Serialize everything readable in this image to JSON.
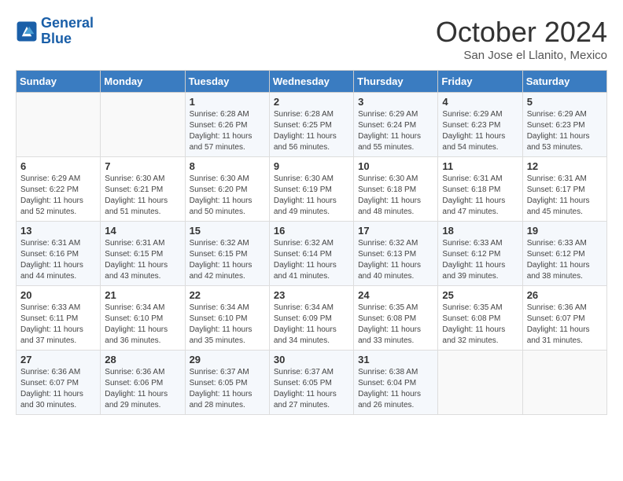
{
  "logo": {
    "text_general": "General",
    "text_blue": "Blue"
  },
  "header": {
    "month": "October 2024",
    "location": "San Jose el Llanito, Mexico"
  },
  "weekdays": [
    "Sunday",
    "Monday",
    "Tuesday",
    "Wednesday",
    "Thursday",
    "Friday",
    "Saturday"
  ],
  "weeks": [
    [
      {
        "day": "",
        "sunrise": "",
        "sunset": "",
        "daylight": ""
      },
      {
        "day": "",
        "sunrise": "",
        "sunset": "",
        "daylight": ""
      },
      {
        "day": "1",
        "sunrise": "Sunrise: 6:28 AM",
        "sunset": "Sunset: 6:26 PM",
        "daylight": "Daylight: 11 hours and 57 minutes."
      },
      {
        "day": "2",
        "sunrise": "Sunrise: 6:28 AM",
        "sunset": "Sunset: 6:25 PM",
        "daylight": "Daylight: 11 hours and 56 minutes."
      },
      {
        "day": "3",
        "sunrise": "Sunrise: 6:29 AM",
        "sunset": "Sunset: 6:24 PM",
        "daylight": "Daylight: 11 hours and 55 minutes."
      },
      {
        "day": "4",
        "sunrise": "Sunrise: 6:29 AM",
        "sunset": "Sunset: 6:23 PM",
        "daylight": "Daylight: 11 hours and 54 minutes."
      },
      {
        "day": "5",
        "sunrise": "Sunrise: 6:29 AM",
        "sunset": "Sunset: 6:23 PM",
        "daylight": "Daylight: 11 hours and 53 minutes."
      }
    ],
    [
      {
        "day": "6",
        "sunrise": "Sunrise: 6:29 AM",
        "sunset": "Sunset: 6:22 PM",
        "daylight": "Daylight: 11 hours and 52 minutes."
      },
      {
        "day": "7",
        "sunrise": "Sunrise: 6:30 AM",
        "sunset": "Sunset: 6:21 PM",
        "daylight": "Daylight: 11 hours and 51 minutes."
      },
      {
        "day": "8",
        "sunrise": "Sunrise: 6:30 AM",
        "sunset": "Sunset: 6:20 PM",
        "daylight": "Daylight: 11 hours and 50 minutes."
      },
      {
        "day": "9",
        "sunrise": "Sunrise: 6:30 AM",
        "sunset": "Sunset: 6:19 PM",
        "daylight": "Daylight: 11 hours and 49 minutes."
      },
      {
        "day": "10",
        "sunrise": "Sunrise: 6:30 AM",
        "sunset": "Sunset: 6:18 PM",
        "daylight": "Daylight: 11 hours and 48 minutes."
      },
      {
        "day": "11",
        "sunrise": "Sunrise: 6:31 AM",
        "sunset": "Sunset: 6:18 PM",
        "daylight": "Daylight: 11 hours and 47 minutes."
      },
      {
        "day": "12",
        "sunrise": "Sunrise: 6:31 AM",
        "sunset": "Sunset: 6:17 PM",
        "daylight": "Daylight: 11 hours and 45 minutes."
      }
    ],
    [
      {
        "day": "13",
        "sunrise": "Sunrise: 6:31 AM",
        "sunset": "Sunset: 6:16 PM",
        "daylight": "Daylight: 11 hours and 44 minutes."
      },
      {
        "day": "14",
        "sunrise": "Sunrise: 6:31 AM",
        "sunset": "Sunset: 6:15 PM",
        "daylight": "Daylight: 11 hours and 43 minutes."
      },
      {
        "day": "15",
        "sunrise": "Sunrise: 6:32 AM",
        "sunset": "Sunset: 6:15 PM",
        "daylight": "Daylight: 11 hours and 42 minutes."
      },
      {
        "day": "16",
        "sunrise": "Sunrise: 6:32 AM",
        "sunset": "Sunset: 6:14 PM",
        "daylight": "Daylight: 11 hours and 41 minutes."
      },
      {
        "day": "17",
        "sunrise": "Sunrise: 6:32 AM",
        "sunset": "Sunset: 6:13 PM",
        "daylight": "Daylight: 11 hours and 40 minutes."
      },
      {
        "day": "18",
        "sunrise": "Sunrise: 6:33 AM",
        "sunset": "Sunset: 6:12 PM",
        "daylight": "Daylight: 11 hours and 39 minutes."
      },
      {
        "day": "19",
        "sunrise": "Sunrise: 6:33 AM",
        "sunset": "Sunset: 6:12 PM",
        "daylight": "Daylight: 11 hours and 38 minutes."
      }
    ],
    [
      {
        "day": "20",
        "sunrise": "Sunrise: 6:33 AM",
        "sunset": "Sunset: 6:11 PM",
        "daylight": "Daylight: 11 hours and 37 minutes."
      },
      {
        "day": "21",
        "sunrise": "Sunrise: 6:34 AM",
        "sunset": "Sunset: 6:10 PM",
        "daylight": "Daylight: 11 hours and 36 minutes."
      },
      {
        "day": "22",
        "sunrise": "Sunrise: 6:34 AM",
        "sunset": "Sunset: 6:10 PM",
        "daylight": "Daylight: 11 hours and 35 minutes."
      },
      {
        "day": "23",
        "sunrise": "Sunrise: 6:34 AM",
        "sunset": "Sunset: 6:09 PM",
        "daylight": "Daylight: 11 hours and 34 minutes."
      },
      {
        "day": "24",
        "sunrise": "Sunrise: 6:35 AM",
        "sunset": "Sunset: 6:08 PM",
        "daylight": "Daylight: 11 hours and 33 minutes."
      },
      {
        "day": "25",
        "sunrise": "Sunrise: 6:35 AM",
        "sunset": "Sunset: 6:08 PM",
        "daylight": "Daylight: 11 hours and 32 minutes."
      },
      {
        "day": "26",
        "sunrise": "Sunrise: 6:36 AM",
        "sunset": "Sunset: 6:07 PM",
        "daylight": "Daylight: 11 hours and 31 minutes."
      }
    ],
    [
      {
        "day": "27",
        "sunrise": "Sunrise: 6:36 AM",
        "sunset": "Sunset: 6:07 PM",
        "daylight": "Daylight: 11 hours and 30 minutes."
      },
      {
        "day": "28",
        "sunrise": "Sunrise: 6:36 AM",
        "sunset": "Sunset: 6:06 PM",
        "daylight": "Daylight: 11 hours and 29 minutes."
      },
      {
        "day": "29",
        "sunrise": "Sunrise: 6:37 AM",
        "sunset": "Sunset: 6:05 PM",
        "daylight": "Daylight: 11 hours and 28 minutes."
      },
      {
        "day": "30",
        "sunrise": "Sunrise: 6:37 AM",
        "sunset": "Sunset: 6:05 PM",
        "daylight": "Daylight: 11 hours and 27 minutes."
      },
      {
        "day": "31",
        "sunrise": "Sunrise: 6:38 AM",
        "sunset": "Sunset: 6:04 PM",
        "daylight": "Daylight: 11 hours and 26 minutes."
      },
      {
        "day": "",
        "sunrise": "",
        "sunset": "",
        "daylight": ""
      },
      {
        "day": "",
        "sunrise": "",
        "sunset": "",
        "daylight": ""
      }
    ]
  ]
}
